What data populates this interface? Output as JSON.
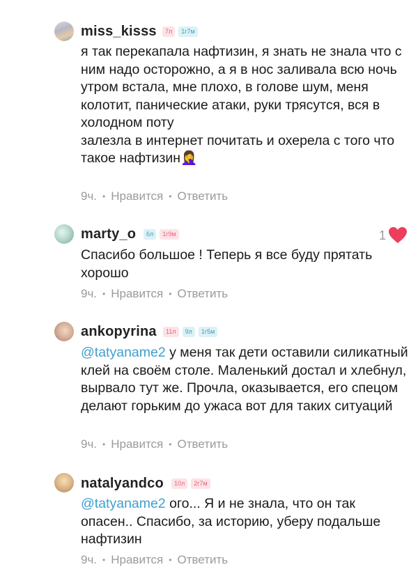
{
  "comments": [
    {
      "username": "miss_kisss",
      "badges": [
        "7л",
        "1г7м"
      ],
      "text": "я так перекапала нафтизин, я знать не знала что с ним надо осторожно, а я в нос заливала всю ночь\nутром встала, мне плохо, в голове шум, меня колотит, панические атаки, руки трясутся, вся в холодном поту\nзалезла в интернет почитать и охерела с того что такое нафтизин",
      "emoji": "🤦‍♀️",
      "time": "9ч.",
      "like_label": "Нравится",
      "reply_label": "Ответить"
    },
    {
      "username": "marty_o",
      "badges": [
        "6л",
        "1г9м"
      ],
      "text": "Спасибо большое ! Теперь я все буду прятать хорошо",
      "time": "9ч.",
      "like_label": "Нравится",
      "reply_label": "Ответить",
      "likes": "1"
    },
    {
      "username": "ankopyrina",
      "badges": [
        "11л",
        "9л",
        "1г5м"
      ],
      "mention": "@tatyaname2",
      "text": " у меня так дети оставили силикатный клей на своём столе. Маленький достал и хлебнул, вырвало тут же. Прочла, оказывается, его спецом делают горьким до ужаса вот для таких ситуаций",
      "time": "9ч.",
      "like_label": "Нравится",
      "reply_label": "Ответить"
    },
    {
      "username": "natalyandco",
      "badges": [
        "10л",
        "2г7м"
      ],
      "mention": "@tatyaname2",
      "text": " ого... Я и не знала, что он так опасен.. Спасибо, за историю, уберу подальше нафтизин",
      "time": "9ч.",
      "like_label": "Нравится",
      "reply_label": "Ответить"
    }
  ],
  "colors": {
    "badge_pink": "#fde3e6",
    "badge_blue": "#ddf1f6",
    "mention": "#3f9fcf",
    "heart": "#ee3e5b"
  }
}
